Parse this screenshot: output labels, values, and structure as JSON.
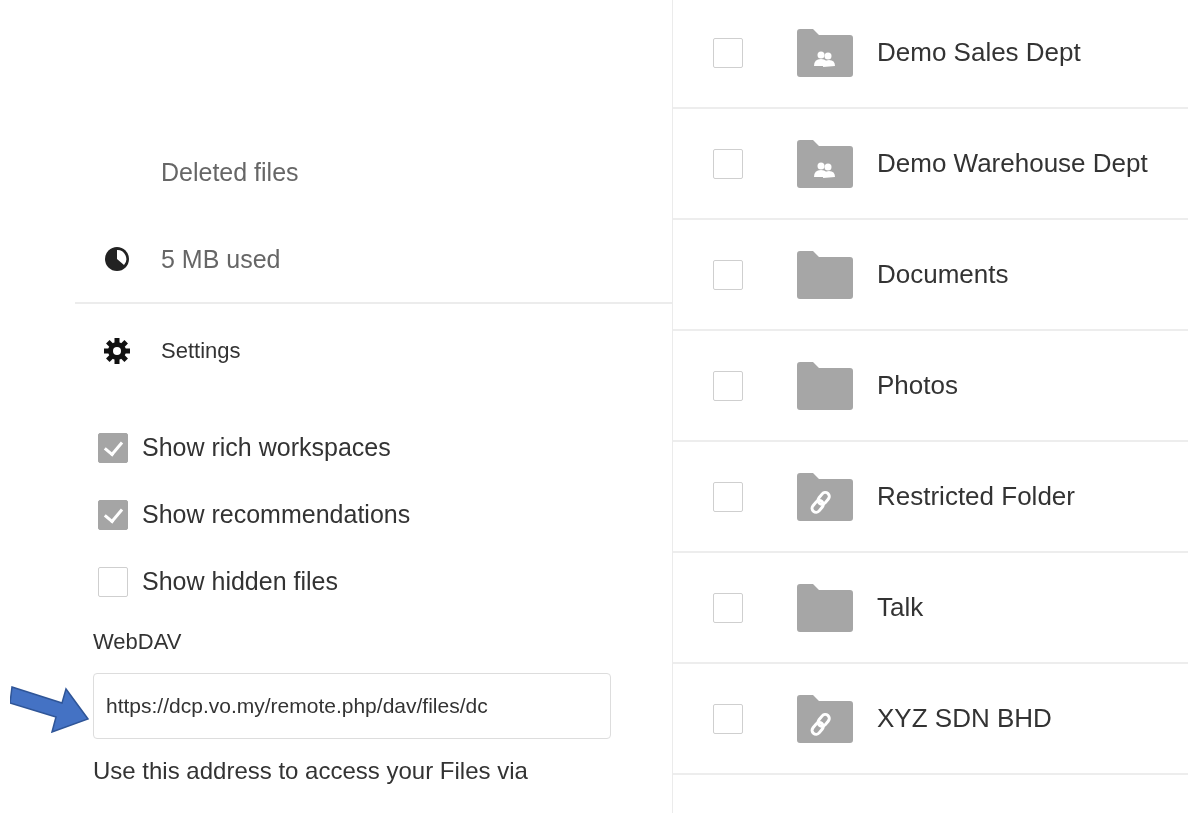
{
  "sidebar": {
    "deleted_files": "Deleted files",
    "quota": {
      "label": "5 MB used"
    },
    "settings": {
      "label": "Settings",
      "options": [
        {
          "label": "Show rich workspaces",
          "checked": true
        },
        {
          "label": "Show recommendations",
          "checked": true
        },
        {
          "label": "Show hidden files",
          "checked": false
        }
      ],
      "webdav": {
        "label": "WebDAV",
        "value": "https://dcp.vo.my/remote.php/dav/files/dc",
        "help": "Use this address to access your Files via"
      }
    }
  },
  "files": [
    {
      "name": "Demo Sales Dept",
      "kind": "shared",
      "checked": false
    },
    {
      "name": "Demo Warehouse Dept",
      "kind": "shared",
      "checked": false
    },
    {
      "name": "Documents",
      "kind": "plain",
      "checked": false
    },
    {
      "name": "Photos",
      "kind": "plain",
      "checked": false
    },
    {
      "name": "Restricted Folder",
      "kind": "link",
      "checked": false
    },
    {
      "name": "Talk",
      "kind": "plain",
      "checked": false
    },
    {
      "name": "XYZ SDN BHD",
      "kind": "link",
      "checked": false
    }
  ]
}
